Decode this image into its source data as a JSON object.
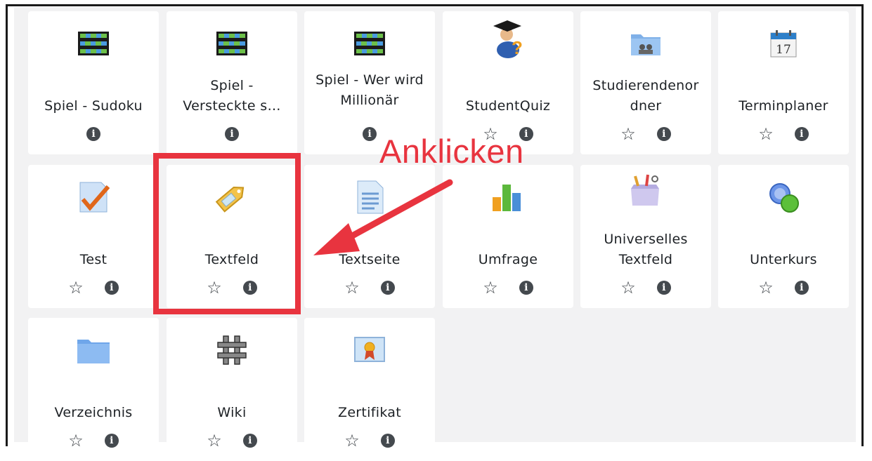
{
  "annotation": {
    "label": "Anklicken",
    "color": "#e8343f"
  },
  "tiles": [
    {
      "label": "Spiel - Sudoku",
      "icon": "game-grid-icon",
      "star": false
    },
    {
      "label": "Spiel - Versteckte s…",
      "icon": "game-grid-icon",
      "star": false
    },
    {
      "label": "Spiel - Wer wird Millionär",
      "icon": "game-grid-icon",
      "star": false
    },
    {
      "label": "StudentQuiz",
      "icon": "student-quiz-icon",
      "star": true
    },
    {
      "label": "Studierendenordner",
      "icon": "group-folder-icon",
      "star": true
    },
    {
      "label": "Terminplaner",
      "icon": "calendar-icon",
      "star": true
    },
    {
      "label": "Test",
      "icon": "quiz-check-icon",
      "star": true
    },
    {
      "label": "Textfeld",
      "icon": "label-tag-icon",
      "star": true
    },
    {
      "label": "Textseite",
      "icon": "page-icon",
      "star": true
    },
    {
      "label": "Umfrage",
      "icon": "bar-chart-icon",
      "star": true
    },
    {
      "label": "Universelles Textfeld",
      "icon": "craft-box-icon",
      "star": true
    },
    {
      "label": "Unterkurs",
      "icon": "subcourse-icon",
      "star": true
    },
    {
      "label": "Verzeichnis",
      "icon": "folder-icon",
      "star": true
    },
    {
      "label": "Wiki",
      "icon": "wiki-icon",
      "star": true
    },
    {
      "label": "Zertifikat",
      "icon": "certificate-icon",
      "star": true
    }
  ],
  "labels_display": {
    "t1": [
      "Spiel - Sudoku"
    ],
    "t2": [
      "Spiel -",
      "Versteckte s…"
    ],
    "t3": [
      "Spiel - Wer wird",
      "Millionär"
    ],
    "t5": [
      "Studierendenor",
      "dner"
    ],
    "t11": [
      "Universelles",
      "Textfeld"
    ]
  }
}
